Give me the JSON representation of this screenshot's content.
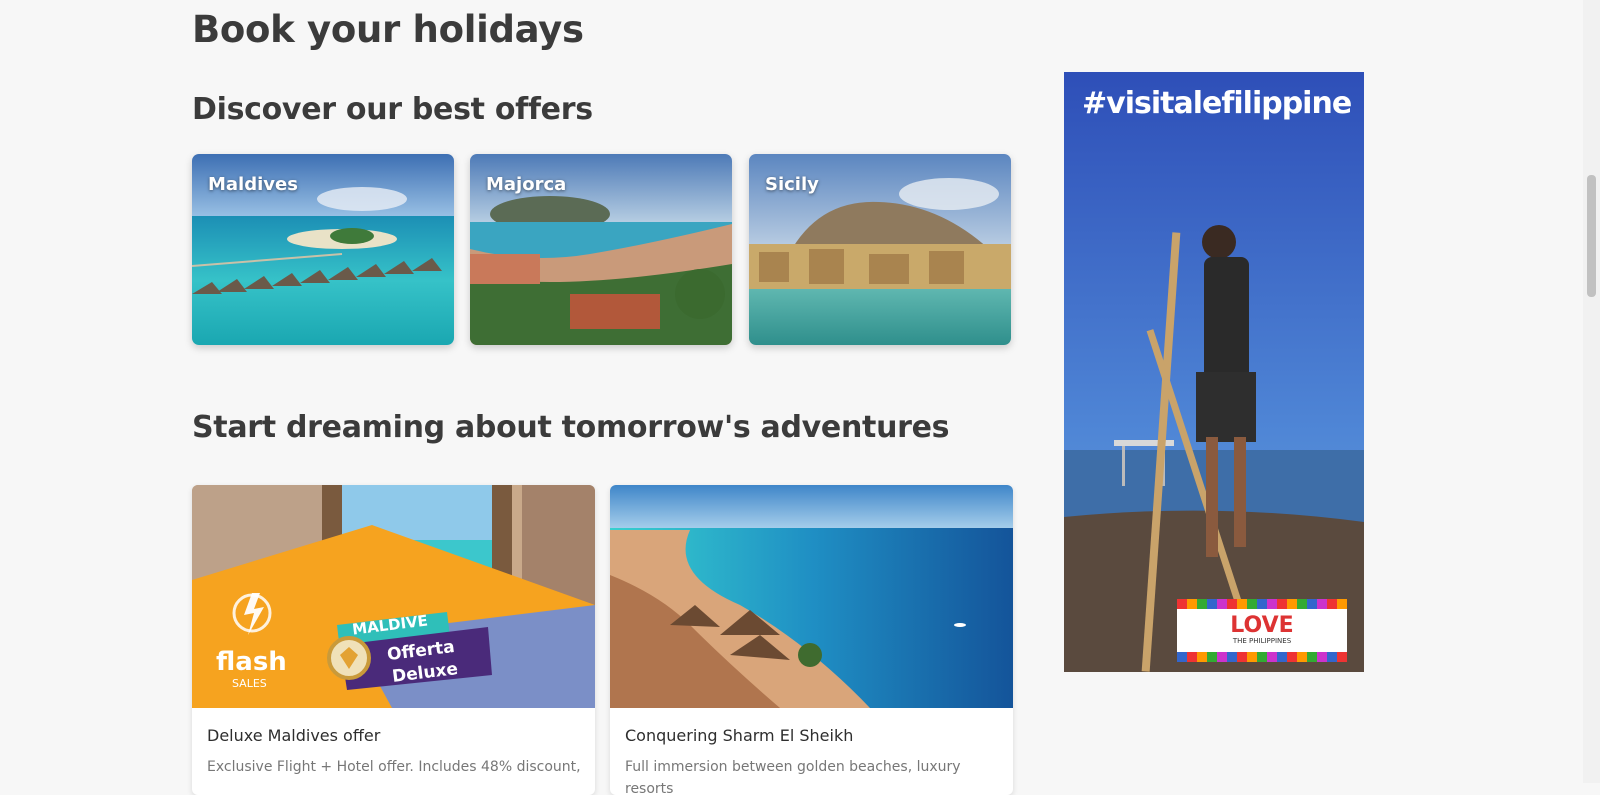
{
  "page": {
    "title": "Book your holidays"
  },
  "offers": {
    "heading": "Discover our best offers",
    "items": [
      {
        "label": "Maldives"
      },
      {
        "label": "Majorca"
      },
      {
        "label": "Sicily"
      }
    ]
  },
  "dreams": {
    "heading": "Start dreaming about tomorrow's adventures",
    "items": [
      {
        "title": "Deluxe Maldives offer",
        "description": "Exclusive Flight + Hotel offer. Includes 48% discount,",
        "badge_flash": "flash",
        "badge_sales": "SALES",
        "badge_destination": "MALDIVE",
        "badge_offer_line1": "Offerta",
        "badge_offer_line2": "Deluxe"
      },
      {
        "title": "Conquering Sharm El Sheikh",
        "description": "Full immersion between golden beaches, luxury resorts"
      }
    ]
  },
  "ad": {
    "hashtag": "#visitalefilippine",
    "love": "LOVE",
    "love_sub": "THE PHILIPPINES"
  }
}
